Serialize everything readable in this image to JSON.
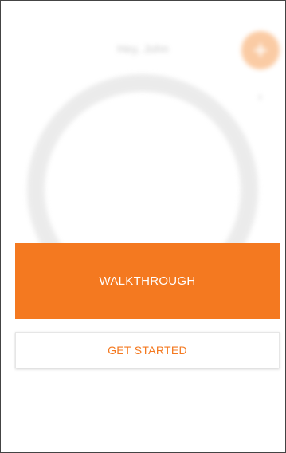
{
  "background": {
    "greeting": "Hey, John"
  },
  "buttons": {
    "walkthrough_label": "WALKTHROUGH",
    "get_started_label": "GET STARTED"
  },
  "colors": {
    "accent": "#f47920",
    "accent_faded": "#f7a15a",
    "ring": "#dcdcdc"
  },
  "icons": {
    "add": "plus-icon"
  }
}
